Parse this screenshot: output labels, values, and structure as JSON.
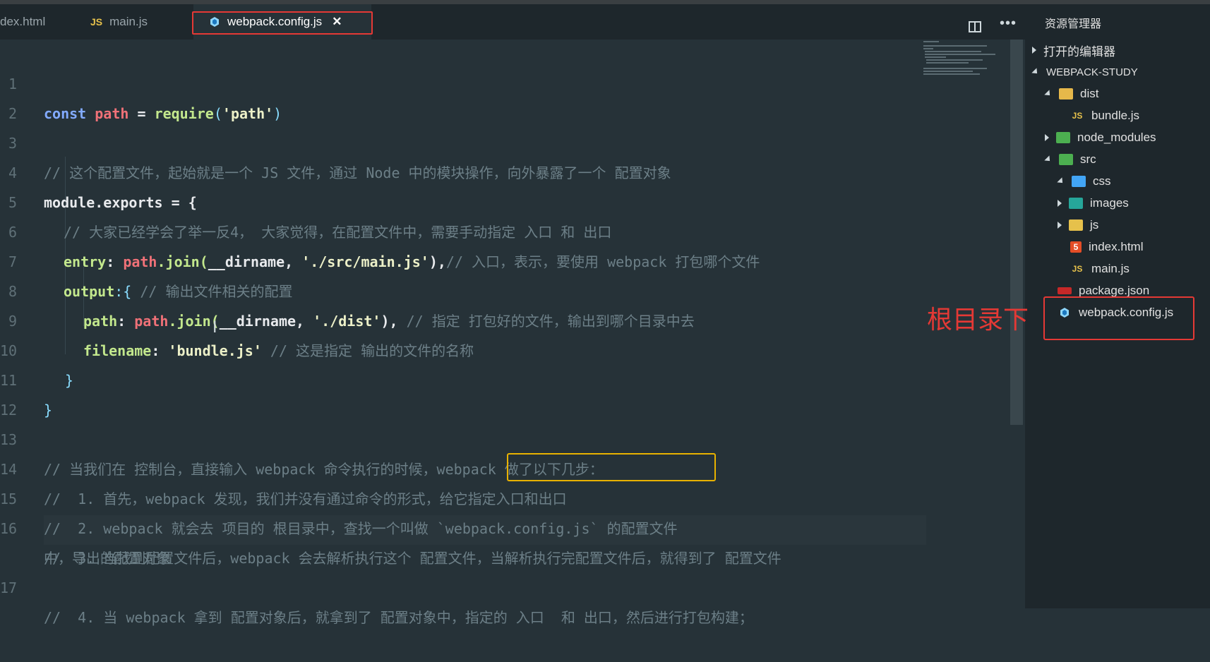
{
  "tabs": [
    {
      "label": "dex.html",
      "icon": "html-icon"
    },
    {
      "label": "main.js",
      "icon": "js-icon",
      "badge": "JS"
    },
    {
      "label": "webpack.config.js",
      "icon": "webpack-icon",
      "active": true
    }
  ],
  "explorer": {
    "title": "资源管理器",
    "open_editors": "打开的编辑器",
    "project": "WEBPACK-STUDY",
    "items": [
      {
        "label": "dist",
        "icon": "folder-icon"
      },
      {
        "label": "bundle.js",
        "icon": "js-icon"
      },
      {
        "label": "node_modules",
        "icon": "folder-icon"
      },
      {
        "label": "src",
        "icon": "folder-icon"
      },
      {
        "label": "css",
        "icon": "folder-icon"
      },
      {
        "label": "images",
        "icon": "folder-icon"
      },
      {
        "label": "js",
        "icon": "folder-icon"
      },
      {
        "label": "index.html",
        "icon": "html-icon"
      },
      {
        "label": "main.js",
        "icon": "js-icon"
      },
      {
        "label": "package.json",
        "icon": "npm-icon"
      },
      {
        "label": "webpack.config.js",
        "icon": "webpack-icon",
        "selected": true
      }
    ]
  },
  "annotation": "根目录下",
  "js_badge": "JS",
  "editor": {
    "line_numbers": [
      "1",
      "2",
      "3",
      "4",
      "5",
      "6",
      "7",
      "8",
      "9",
      "10",
      "11",
      "12",
      "13",
      "14",
      "15",
      "16",
      "17"
    ],
    "l1": {
      "kw": "const",
      "var": "path",
      "eq": " = ",
      "fn": "require",
      "p1": "(",
      "str": "'path'",
      "p2": ")"
    },
    "l3": "// 这个配置文件，起始就是一个 JS 文件，通过 Node 中的模块操作，向外暴露了一个 配置对象",
    "l4": {
      "id": "module.exports",
      "rest": " = {"
    },
    "l5": "// 大家已经学会了举一反4， 大家觉得，在配置文件中，需要手动指定 入口 和 出口",
    "l6": {
      "key": "entry",
      "colon": ": ",
      "var": "path",
      "fn": ".join(",
      "arg": "__dirname, ",
      "str": "'./src/main.js'",
      "close": "),",
      "cm": "// 入口，表示，要使用 webpack 打包哪个文件"
    },
    "l7": {
      "key": "output",
      "colon": ":{ ",
      "cm": "// 输出文件相关的配置"
    },
    "l8": {
      "key": "path",
      "colon": ": ",
      "var": "path",
      "fn": ".join(",
      "arg": "__dirname, ",
      "str": "'./dist'",
      "close": "), ",
      "cm": "// 指定 打包好的文件，输出到哪个目录中去"
    },
    "l9": {
      "key": "filename",
      "colon": ": ",
      "str": "'bundle.js'",
      "cm": " // 这是指定 输出的文件的名称"
    },
    "l10": "}",
    "l11": "}",
    "l13": "// 当我们在 控制台，直接输入 webpack 命令执行的时候，webpack 做了以下几步：",
    "l14": "//  1. 首先，webpack 发现，我们并没有通过命令的形式，给它指定入口和出口",
    "l15a": "//  2. webpack 就会去 项目的 根目录中，查找一个叫做 ",
    "l15b": "`webpack.config.js`",
    "l15c": " 的配置文件",
    "l16a": "//  3. 当找到配置文件后，webpack 会去解析执行这个 配置文件，当解析执行完配置文件后，就得到了 配置文件",
    "l16b": "中，导出的配置对象",
    "l17": "//  4. 当 webpack 拿到 配置对象后，就拿到了 配置对象中，指定的 入口  和 出口，然后进行打包构建；"
  },
  "colors": {
    "keyword": "#82aaff",
    "variable": "#f07178",
    "function": "#c3e88d",
    "comment": "#6c7f87",
    "highlight_box": "#e8b200",
    "annotation_red": "#e53935"
  }
}
